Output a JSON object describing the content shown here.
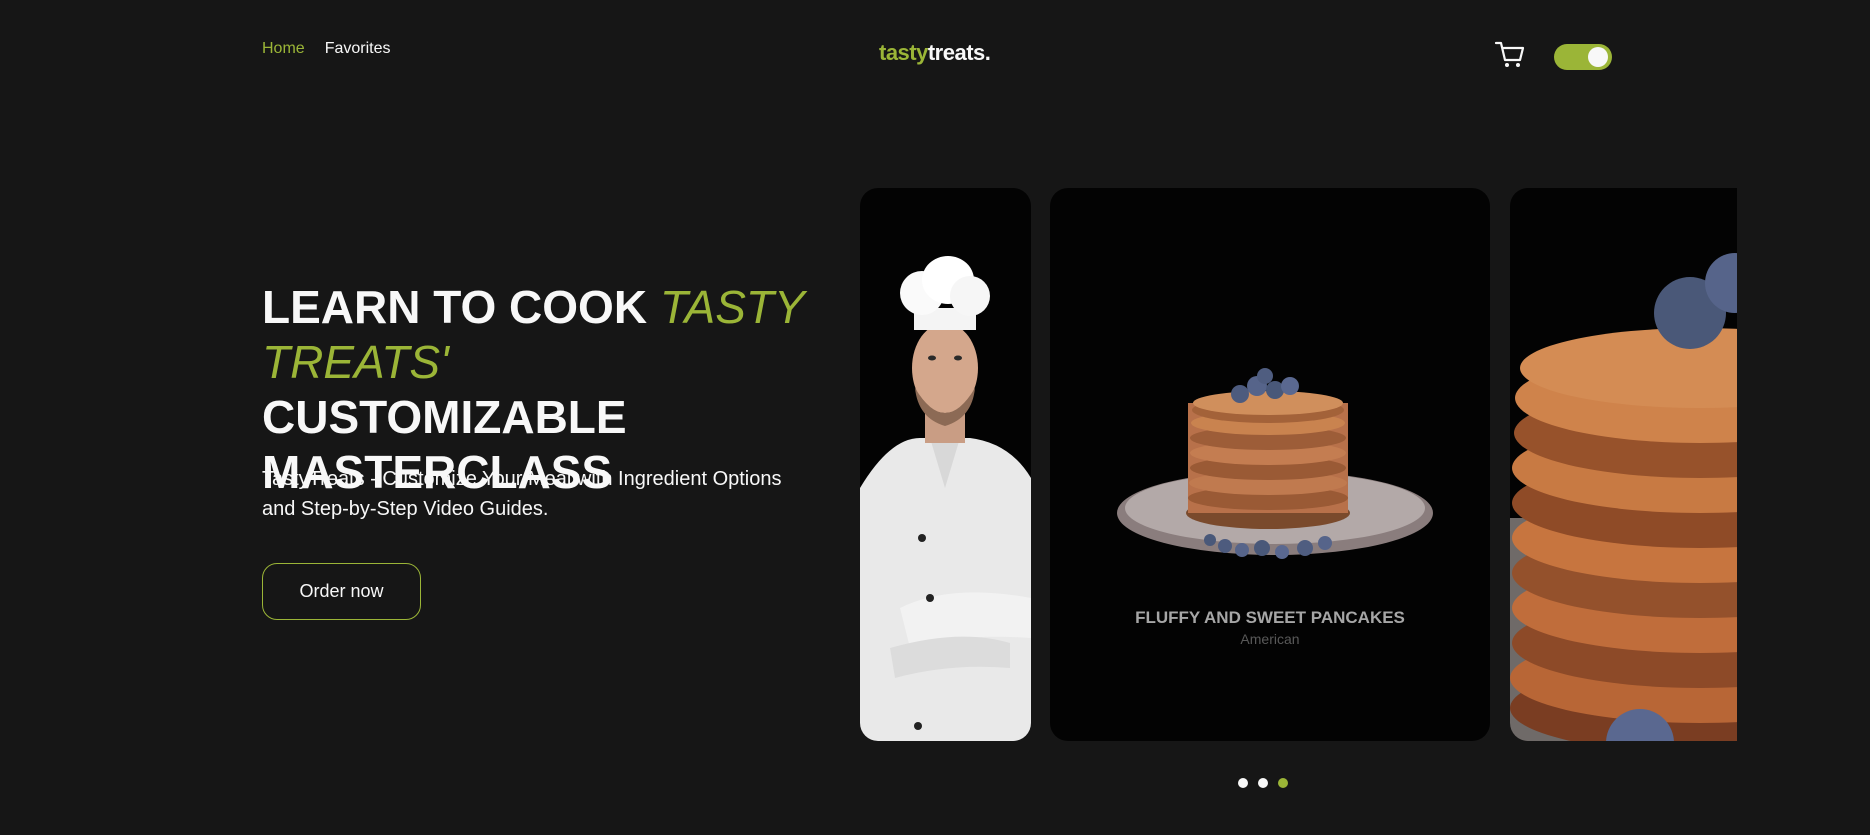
{
  "nav": {
    "items": [
      {
        "label": "Home",
        "active": true
      },
      {
        "label": "Favorites",
        "active": false
      }
    ]
  },
  "logo": {
    "part1": "tasty",
    "part2": "treats."
  },
  "header": {
    "cart_icon": "cart-icon",
    "theme_toggle": {
      "on": true
    }
  },
  "hero": {
    "title_part1": "LEARN TO COOK",
    "title_accent": "TASTY TREATS'",
    "title_part2": "CUSTOMIZABLE MASTERCLASS",
    "description": "TastyTreats - Customize Your Meal with Ingredient Options and Step-by-Step Video Guides.",
    "button_label": "Order now"
  },
  "slider": {
    "cards": [
      {
        "image": "chef-photo"
      },
      {
        "image": "pancake-stack-photo",
        "title": "FLUFFY AND SWEET PANCAKES",
        "subtitle": "American"
      },
      {
        "image": "pancake-closeup-photo"
      }
    ],
    "dots": [
      {
        "active": false
      },
      {
        "active": false
      },
      {
        "active": true
      }
    ]
  },
  "colors": {
    "accent": "#9bb537",
    "background": "#161616",
    "card": "#030303",
    "text": "#f8f8f8"
  }
}
